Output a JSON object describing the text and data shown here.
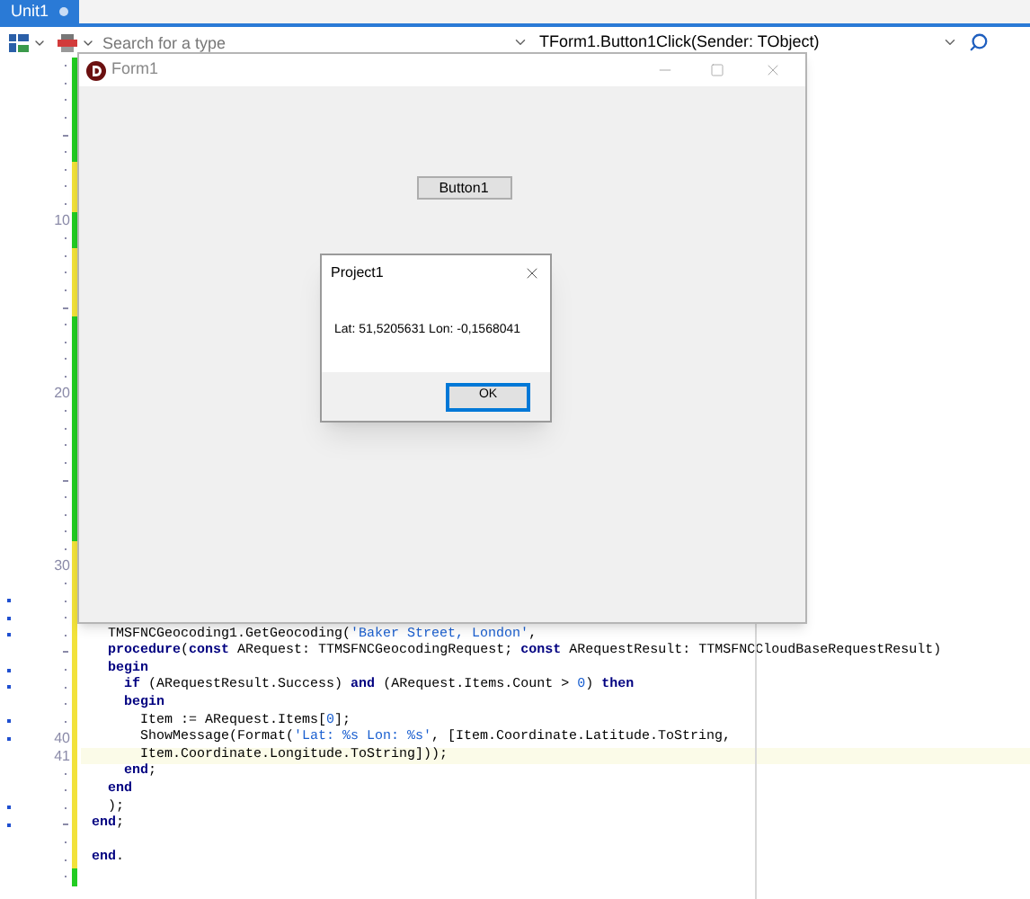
{
  "tab": {
    "label": "Unit1",
    "selected": true
  },
  "toolbar": {
    "search": {
      "placeholder": "Search for a type"
    },
    "method_combo": {
      "value": "TForm1.Button1Click(Sender: TObject)"
    }
  },
  "editor": {
    "lines": [
      {
        "kind": "dot",
        "saved": true,
        "modified": false,
        "current": false
      },
      {
        "kind": "dot",
        "saved": true,
        "modified": false,
        "current": false
      },
      {
        "kind": "dot",
        "saved": true,
        "modified": false,
        "current": false
      },
      {
        "kind": "dot",
        "saved": true,
        "modified": false,
        "current": false
      },
      {
        "kind": "dash",
        "saved": true,
        "modified": false,
        "current": false
      },
      {
        "kind": "dot",
        "saved": true,
        "modified": false,
        "current": false
      },
      {
        "kind": "dot",
        "saved": false,
        "modified": false,
        "current": false
      },
      {
        "kind": "dot",
        "saved": false,
        "modified": false,
        "current": false
      },
      {
        "kind": "dot",
        "saved": false,
        "modified": false,
        "current": false
      },
      {
        "kind": "number",
        "number": "10",
        "saved": true,
        "modified": false,
        "current": false
      },
      {
        "kind": "dot",
        "saved": true,
        "modified": false,
        "current": false
      },
      {
        "kind": "dot",
        "saved": false,
        "modified": false,
        "current": false
      },
      {
        "kind": "dot",
        "saved": false,
        "modified": false,
        "current": false
      },
      {
        "kind": "dot",
        "saved": false,
        "modified": false,
        "current": false
      },
      {
        "kind": "dash",
        "saved": false,
        "modified": false,
        "current": false
      },
      {
        "kind": "dot",
        "saved": true,
        "modified": false,
        "current": false
      },
      {
        "kind": "dot",
        "saved": true,
        "modified": false,
        "current": false
      },
      {
        "kind": "dot",
        "saved": true,
        "modified": false,
        "current": false
      },
      {
        "kind": "dot",
        "saved": true,
        "modified": false,
        "current": false
      },
      {
        "kind": "number",
        "number": "20",
        "saved": true,
        "modified": false,
        "current": false
      },
      {
        "kind": "dot",
        "saved": true,
        "modified": false,
        "current": false
      },
      {
        "kind": "dot",
        "saved": true,
        "modified": false,
        "current": false
      },
      {
        "kind": "dot",
        "saved": true,
        "modified": false,
        "current": false
      },
      {
        "kind": "dot",
        "saved": true,
        "modified": false,
        "current": false
      },
      {
        "kind": "dash",
        "saved": true,
        "modified": false,
        "current": false
      },
      {
        "kind": "dot",
        "saved": true,
        "modified": false,
        "current": false
      },
      {
        "kind": "dot",
        "saved": true,
        "modified": false,
        "current": false
      },
      {
        "kind": "dot",
        "saved": true,
        "modified": false,
        "current": false
      },
      {
        "kind": "dot",
        "saved": false,
        "modified": false,
        "current": false
      },
      {
        "kind": "number",
        "number": "30",
        "saved": false,
        "modified": false,
        "current": false
      },
      {
        "kind": "dot",
        "saved": false,
        "modified": false,
        "current": false
      },
      {
        "kind": "dot",
        "saved": false,
        "modified": true,
        "current": false
      },
      {
        "kind": "dot",
        "saved": false,
        "modified": true,
        "current": false,
        "children": [
          {
            "kind": "dot",
            "saved": false,
            "modified": true,
            "current": false,
            "tokens": [
              {
                "text": "TMSFNCGeocoding1.GetGeocoding(",
                "kind": "plain"
              },
              {
                "text": "'Baker Street, London'",
                "kind": "string"
              },
              {
                "text": ",",
                "kind": "plain"
              }
            ]
          },
          {
            "kind": "dash",
            "saved": false,
            "modified": false,
            "current": false,
            "tokens": [
              {
                "text": "procedure",
                "kind": "keyword"
              },
              {
                "text": "(",
                "kind": "plain"
              },
              {
                "text": "const",
                "kind": "keyword"
              },
              {
                "text": " ARequest: TTMSFNCGeocodingRequest; ",
                "kind": "plain"
              },
              {
                "text": "const",
                "kind": "keyword"
              },
              {
                "text": " ARequestResult: TTMSFNCCloudBaseRequestResult)",
                "kind": "plain"
              }
            ]
          },
          {
            "kind": "dot",
            "saved": false,
            "modified": true,
            "current": false,
            "tokens": [
              {
                "text": "begin",
                "kind": "keyword"
              }
            ],
            "children": [
              {
                "kind": "dot",
                "saved": false,
                "modified": true,
                "current": false,
                "tokens": [
                  {
                    "text": "if",
                    "kind": "keyword"
                  },
                  {
                    "text": " (ARequestResult.Success) ",
                    "kind": "plain"
                  },
                  {
                    "text": "and",
                    "kind": "keyword"
                  },
                  {
                    "text": " (ARequest.Items.Count > ",
                    "kind": "plain"
                  },
                  {
                    "text": "0",
                    "kind": "number"
                  },
                  {
                    "text": ") ",
                    "kind": "plain"
                  },
                  {
                    "text": "then",
                    "kind": "keyword"
                  }
                ]
              },
              {
                "kind": "dot",
                "saved": false,
                "modified": false,
                "current": false,
                "tokens": [
                  {
                    "text": "begin",
                    "kind": "keyword"
                  }
                ],
                "children": [
                  {
                    "kind": "dot",
                    "saved": false,
                    "modified": true,
                    "current": false,
                    "tokens": [
                      {
                        "text": "Item := ARequest.Items[",
                        "kind": "plain"
                      },
                      {
                        "text": "0",
                        "kind": "number"
                      },
                      {
                        "text": "];",
                        "kind": "plain"
                      }
                    ]
                  },
                  {
                    "kind": "number",
                    "number": "40",
                    "saved": false,
                    "modified": true,
                    "current": false,
                    "tokens": [
                      {
                        "text": "ShowMessage(Format(",
                        "kind": "plain"
                      },
                      {
                        "text": "'Lat: %s Lon: %s'",
                        "kind": "string"
                      },
                      {
                        "text": ", [Item.Coordinate.Latitude.ToString,",
                        "kind": "plain"
                      }
                    ]
                  },
                  {
                    "kind": "number",
                    "number": "41",
                    "saved": false,
                    "modified": false,
                    "current": true,
                    "tokens": [
                      {
                        "text": "Item.Coordinate.Longitude.ToString]));",
                        "kind": "plain"
                      }
                    ]
                  }
                ]
              },
              {
                "kind": "dot",
                "saved": false,
                "modified": false,
                "current": false,
                "tokens": [
                  {
                    "text": "end",
                    "kind": "keyword"
                  },
                  {
                    "text": ";",
                    "kind": "plain"
                  }
                ]
              }
            ]
          },
          {
            "kind": "dot",
            "saved": false,
            "modified": false,
            "current": false,
            "tokens": [
              {
                "text": "end",
                "kind": "keyword"
              }
            ]
          },
          {
            "kind": "dot",
            "saved": false,
            "modified": true,
            "current": false,
            "tokens": [
              {
                "text": ");",
                "kind": "plain"
              }
            ]
          }
        ]
      },
      {
        "kind": "dash",
        "saved": false,
        "modified": true,
        "current": false,
        "tokens": [
          {
            "text": "end",
            "kind": "keyword"
          },
          {
            "text": ";",
            "kind": "plain"
          }
        ]
      },
      {
        "kind": "dot",
        "saved": false,
        "modified": false,
        "current": false
      },
      {
        "kind": "dot",
        "saved": false,
        "modified": false,
        "current": false,
        "tokens": [
          {
            "text": "end",
            "kind": "keyword"
          },
          {
            "text": ".",
            "kind": "plain"
          }
        ]
      },
      {
        "kind": "dot",
        "saved": true,
        "modified": false,
        "current": false
      }
    ]
  },
  "form": {
    "title": "Form1",
    "button": "Button1"
  },
  "dialog": {
    "title": "Project1",
    "message": "Lat: 51,5205631 Lon: -0,1568041",
    "button": {
      "label": "OK",
      "focused": true
    }
  }
}
